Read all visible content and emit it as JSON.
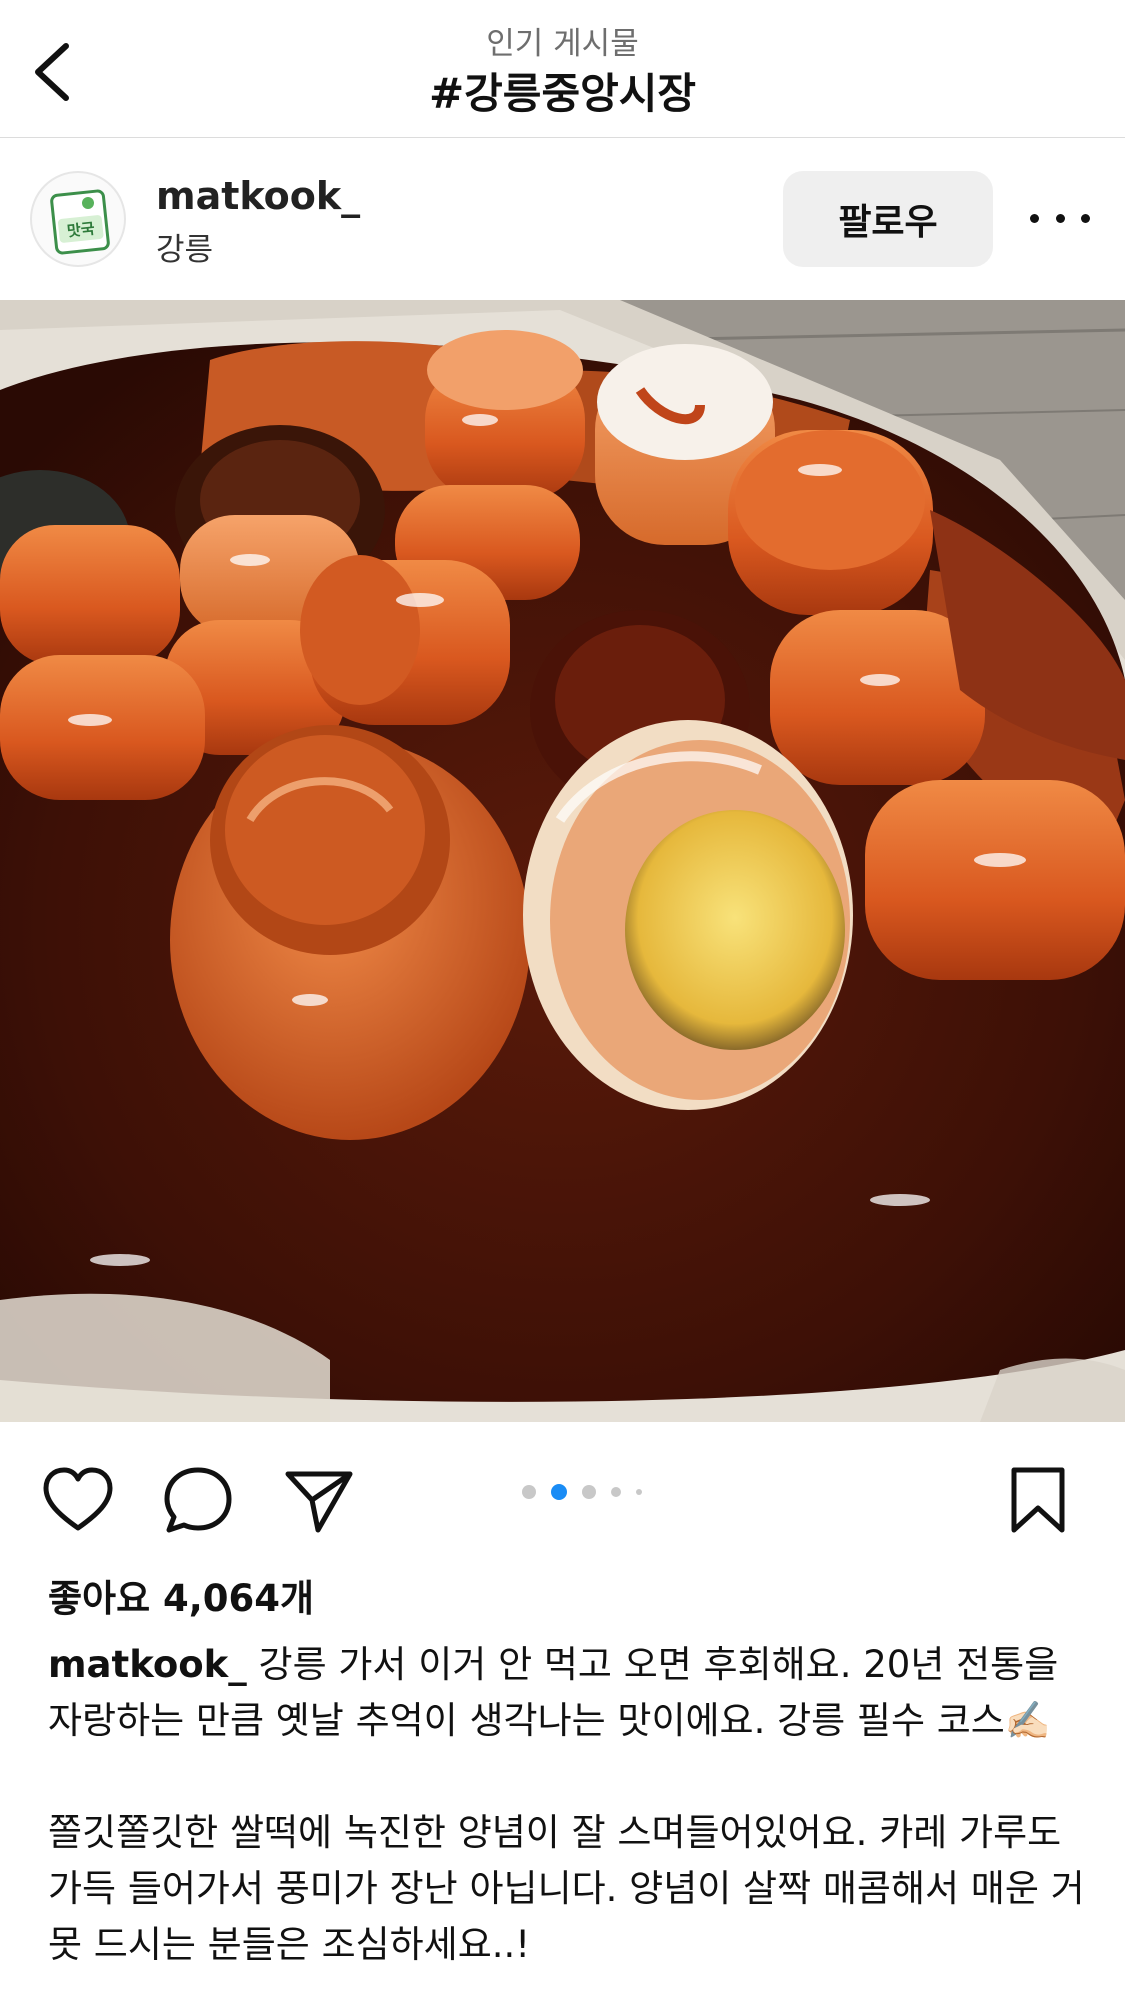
{
  "header": {
    "subtitle": "인기 게시물",
    "title": "#강릉중앙시장",
    "back_icon": "chevron-left-icon"
  },
  "post": {
    "author": "matkook_",
    "location": "강릉",
    "avatar_text": "맛국",
    "follow_label": "팔로우",
    "more_icon": "ellipsis-icon",
    "carousel": {
      "count": 5,
      "active_index": 1
    },
    "actions": {
      "like_icon": "heart-icon",
      "comment_icon": "comment-icon",
      "share_icon": "send-icon",
      "save_icon": "bookmark-icon"
    },
    "likes_text": "좋아요 4,064개",
    "caption_user": "matkook_",
    "caption_line1": " 강릉 가서 이거 안 먹고 오면 후회해요. 20년 전통을 자랑하는 만큼 옛날 추억이 생각나는 맛이에요. 강릉 필수 코스✍🏻",
    "caption_line2": "쫄깃쫄깃한 쌀떡에 녹진한 양념이 잘 스며들어있어요. 카레 가루도 가득 들어가서 풍미가 장난 아닙니다. 양념이 살짝 매콤해서 매운 거 못 드시는 분들은 조심하세요..!"
  },
  "colors": {
    "accent_blue": "#1a8cf5",
    "sauce_dark": "#4a1408",
    "tteok_orange": "#e0662a"
  }
}
